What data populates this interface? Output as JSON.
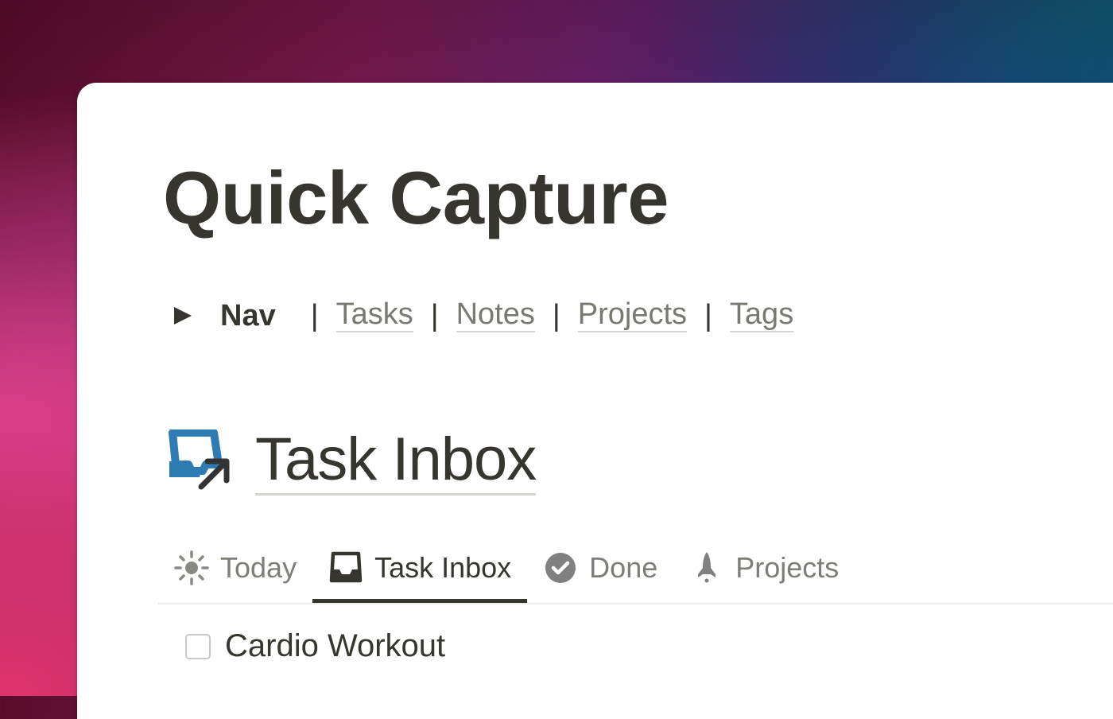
{
  "page": {
    "title": "Quick Capture"
  },
  "nav": {
    "toggle_icon": "triangle-right-icon",
    "label": "Nav",
    "separator": "|",
    "links": [
      {
        "label": "Tasks"
      },
      {
        "label": "Notes"
      },
      {
        "label": "Projects"
      },
      {
        "label": "Tags"
      }
    ]
  },
  "section": {
    "icon": "inbox-arrow-icon",
    "icon_color": "#2e7cb3",
    "title": "Task Inbox"
  },
  "tabs": [
    {
      "label": "Today",
      "icon": "sun-icon",
      "active": false
    },
    {
      "label": "Task Inbox",
      "icon": "inbox-tray-icon",
      "active": true
    },
    {
      "label": "Done",
      "icon": "check-circle-icon",
      "active": false
    },
    {
      "label": "Projects",
      "icon": "rocket-icon",
      "active": false
    }
  ],
  "tasks": [
    {
      "label": "Cardio Workout",
      "checked": false
    }
  ],
  "colors": {
    "text": "#37352f",
    "muted": "#7f7d78",
    "accent_icon": "#2e7cb3"
  }
}
